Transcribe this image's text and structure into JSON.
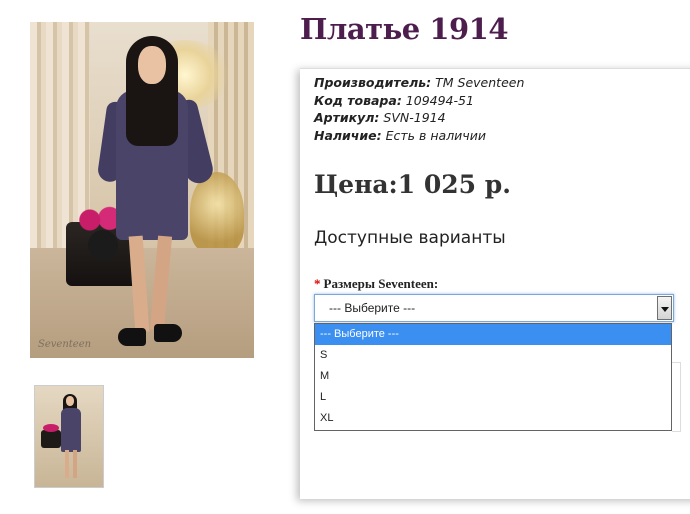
{
  "product": {
    "title": "Платье 1914",
    "manufacturer_label": "Производитель:",
    "manufacturer": "TM Seventeen",
    "code_label": "Код товара:",
    "code": "109494-51",
    "article_label": "Артикул:",
    "article": "SVN-1914",
    "stock_label": "Наличие:",
    "stock": "Есть в наличии",
    "price": "Цена:1 025 р."
  },
  "photo": {
    "signature": "Seventeen"
  },
  "options": {
    "heading": "Доступные варианты",
    "required_mark": "*",
    "size_label": "Размеры Seventeen:",
    "selected": "--- Выберите ---",
    "items": [
      "--- Выберите ---",
      "S",
      "M",
      "L",
      "XL"
    ]
  },
  "colors": {
    "title": "#4d1d4d",
    "highlight": "#3b8ff0",
    "dress": "#4a4468"
  }
}
